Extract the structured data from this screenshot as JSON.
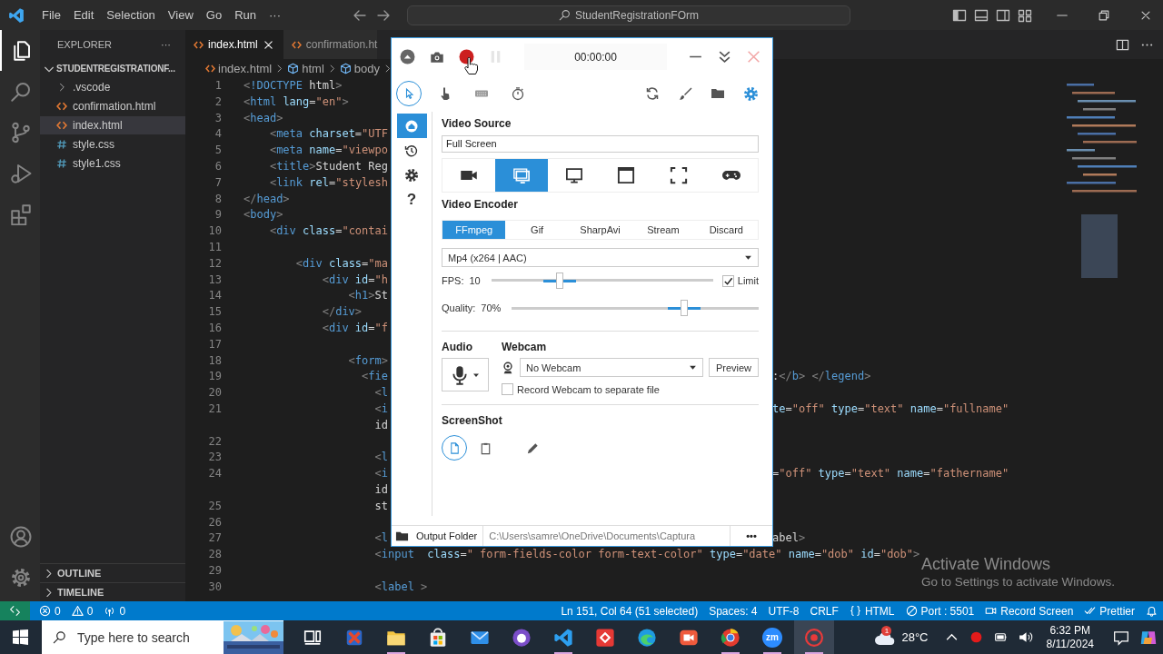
{
  "title_bar": {
    "menu": [
      "File",
      "Edit",
      "Selection",
      "View",
      "Go",
      "Run",
      "···"
    ],
    "search": "StudentRegistrationFOrm"
  },
  "activity_bar": [
    {
      "kind": "explorer",
      "selected": true
    },
    {
      "kind": "search",
      "selected": false
    },
    {
      "kind": "source-control",
      "selected": false
    },
    {
      "kind": "run",
      "selected": false
    },
    {
      "kind": "extensions",
      "selected": false
    }
  ],
  "activity_bottom": [
    {
      "kind": "account"
    },
    {
      "kind": "manage"
    }
  ],
  "explorer": {
    "title": "EXPLORER",
    "more": "···",
    "folder": "STUDENTREGISTRATIONF...",
    "expanded": true,
    "items": [
      {
        "label": ".vscode",
        "kind": "folder",
        "selected": false
      },
      {
        "label": "confirmation.html",
        "kind": "html",
        "selected": false
      },
      {
        "label": "index.html",
        "kind": "html",
        "selected": true
      },
      {
        "label": "style.css",
        "kind": "css",
        "selected": false
      },
      {
        "label": "style1.css",
        "kind": "css",
        "selected": false
      }
    ],
    "sections": [
      {
        "label": "OUTLINE",
        "expanded": false
      },
      {
        "label": "TIMELINE",
        "expanded": false
      }
    ]
  },
  "tabs": [
    {
      "label": "index.html",
      "selected": true
    },
    {
      "label": "confirmation.ht",
      "selected": false
    }
  ],
  "breadcrumb": [
    {
      "label": "index.html",
      "kind": "file"
    },
    {
      "label": "html",
      "kind": "element"
    },
    {
      "label": "body",
      "kind": "element"
    }
  ],
  "code_lines": [
    {
      "number": "1",
      "left": "<!DOCTYPE html>"
    },
    {
      "number": "2",
      "left": "<html lang=\"en\">"
    },
    {
      "number": "3",
      "left": "<head>"
    },
    {
      "number": "4",
      "left": "    <meta charset=\"UTF"
    },
    {
      "number": "5",
      "left": "    <meta name=\"viewpo"
    },
    {
      "number": "6",
      "left": "    <title>Student Reg"
    },
    {
      "number": "7",
      "left": "    <link rel=\"stylesh"
    },
    {
      "number": "8",
      "left": "</head>"
    },
    {
      "number": "9",
      "left": "<body>"
    },
    {
      "number": "10",
      "left": "    <div class=\"contai"
    },
    {
      "number": "11"
    },
    {
      "number": "12",
      "left": "        <div class=\"ma"
    },
    {
      "number": "13",
      "left": "            <div id=\"h"
    },
    {
      "number": "14",
      "left": "                <h1>St"
    },
    {
      "number": "15",
      "left": "            </div>"
    },
    {
      "number": "16",
      "left": "            <div id=\"f"
    },
    {
      "number": "17"
    },
    {
      "number": "18",
      "left": "                <form>"
    },
    {
      "number": "19",
      "left": "                  <fie",
      "right": ":</b> </legend>"
    },
    {
      "number": "20",
      "left": "                    <l"
    },
    {
      "number": "21",
      "left": "                    <i",
      "right": "te=\"off\" type=\"text\" name=\"fullname\""
    },
    {
      "left": "                    id"
    },
    {
      "number": "22"
    },
    {
      "number": "23",
      "left": "                    <l"
    },
    {
      "number": "24",
      "left": "                    <i",
      "right": "=\"off\" type=\"text\" name=\"fathername\""
    },
    {
      "left": "                    id"
    },
    {
      "number": "25",
      "left": "                    st"
    },
    {
      "number": "26"
    },
    {
      "number": "27",
      "left": "                    <l",
      "right": "abel>"
    },
    {
      "number": "28",
      "left": "                    <input  class=\" form-fields-color form-text-color\" type=\"date\" name=\"dob\" id=\"dob\">"
    },
    {
      "number": "29"
    },
    {
      "number": "30",
      "left": "                    <label >"
    }
  ],
  "status_bar": {
    "left": [
      {
        "kind": "remote"
      },
      {
        "kind": "errors",
        "text": "0"
      },
      {
        "kind": "warnings",
        "text": "0"
      },
      {
        "kind": "ports",
        "text": "0"
      }
    ],
    "right": [
      {
        "text": "Ln 151, Col 64 (51 selected)"
      },
      {
        "text": "Spaces: 4"
      },
      {
        "text": "UTF-8"
      },
      {
        "text": "CRLF"
      },
      {
        "kind": "language",
        "text": "HTML"
      },
      {
        "kind": "port",
        "text": "Port : 5501"
      },
      {
        "kind": "record",
        "text": "Record Screen"
      },
      {
        "kind": "prettier",
        "text": "Prettier"
      },
      {
        "kind": "bell"
      }
    ]
  },
  "capture": {
    "top_buttons": [
      {
        "kind": "collapse",
        "disabled": false
      },
      {
        "kind": "camera",
        "disabled": false
      },
      {
        "kind": "record",
        "disabled": false
      },
      {
        "kind": "pause",
        "disabled": true
      }
    ],
    "timer": "00:00:00",
    "window_buttons": [
      {
        "kind": "minimize"
      },
      {
        "kind": "chevrons"
      },
      {
        "kind": "close"
      }
    ],
    "tools": [
      {
        "kind": "cursor",
        "selected": true
      },
      {
        "kind": "clicks",
        "selected": false
      },
      {
        "kind": "keystrokes",
        "selected": false
      },
      {
        "kind": "timer",
        "selected": false
      }
    ],
    "actions": [
      {
        "kind": "refresh"
      },
      {
        "kind": "brush"
      },
      {
        "kind": "folder"
      },
      {
        "kind": "settings"
      }
    ],
    "nav": [
      {
        "kind": "home",
        "selected": true
      },
      {
        "kind": "history",
        "selected": false
      },
      {
        "kind": "settings",
        "selected": false
      },
      {
        "kind": "help",
        "glyph": "?",
        "selected": false
      }
    ],
    "video_source": {
      "label": "Video Source",
      "value": "Full Screen",
      "sources": [
        {
          "kind": "webcam",
          "selected": false
        },
        {
          "kind": "screen",
          "selected": true
        },
        {
          "kind": "monitor",
          "selected": false
        },
        {
          "kind": "window",
          "selected": false
        },
        {
          "kind": "region",
          "selected": false
        },
        {
          "kind": "game",
          "selected": false
        }
      ]
    },
    "video_encoder": {
      "label": "Video Encoder",
      "tabs": [
        {
          "label": "FFmpeg",
          "selected": true
        },
        {
          "label": "Gif",
          "selected": false
        },
        {
          "label": "SharpAvi",
          "selected": false
        },
        {
          "label": "Stream",
          "selected": false
        },
        {
          "label": "Discard",
          "selected": false
        }
      ],
      "format": "Mp4 (x264 | AAC)"
    },
    "fps": {
      "label": "FPS:",
      "value": "10",
      "level": 0.31,
      "limit": {
        "label": "Limit",
        "checked": true
      }
    },
    "quality": {
      "label": "Quality:",
      "value": "70%",
      "level": 0.7
    },
    "audio": {
      "label": "Audio"
    },
    "webcam": {
      "label": "Webcam",
      "device": "No Webcam",
      "preview": "Preview",
      "separate_file": {
        "label": "Record Webcam to separate file",
        "checked": false
      }
    },
    "screenshot": {
      "label": "ScreenShot",
      "targets": [
        {
          "kind": "disk",
          "selected": true
        },
        {
          "kind": "clipboard",
          "selected": false
        },
        {
          "kind": "editor",
          "selected": false
        }
      ]
    },
    "output": {
      "label": "Output Folder",
      "path": "C:\\Users\\samre\\OneDrive\\Documents\\Captura",
      "more": "•••"
    }
  },
  "activation_notice": {
    "title": "Activate Windows",
    "text": "Go to Settings to activate Windows."
  },
  "taskbar": {
    "search_placeholder": "Type here to search",
    "apps": [
      {
        "kind": "task-view",
        "running": false,
        "selected": false
      },
      {
        "kind": "red-app",
        "running": false,
        "selected": false
      },
      {
        "kind": "files",
        "running": true,
        "selected": false
      },
      {
        "kind": "store",
        "running": false,
        "selected": false
      },
      {
        "kind": "mail",
        "running": false,
        "selected": false
      },
      {
        "kind": "purple-app",
        "running": false,
        "selected": false
      },
      {
        "kind": "code",
        "running": true,
        "selected": false
      },
      {
        "kind": "remote-app",
        "running": false,
        "selected": false
      },
      {
        "kind": "browser-wave",
        "running": false,
        "selected": false
      },
      {
        "kind": "video-app",
        "running": false,
        "selected": false
      },
      {
        "kind": "browser-ring",
        "running": true,
        "selected": false
      },
      {
        "kind": "zm",
        "text": "zm",
        "running": true,
        "selected": false
      },
      {
        "kind": "recorder",
        "running": true,
        "selected": true
      }
    ],
    "weather": {
      "temperature": "28°C",
      "badge": "1"
    },
    "tray": [
      {
        "kind": "caret"
      },
      {
        "kind": "record"
      },
      {
        "kind": "battery"
      },
      {
        "kind": "volume"
      }
    ],
    "time": "6:32 PM",
    "date": "8/11/2024"
  }
}
